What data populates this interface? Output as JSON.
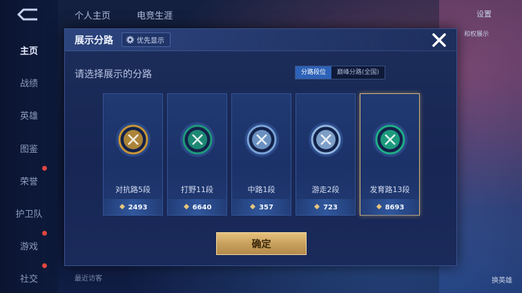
{
  "background": {
    "nav": [
      "主页",
      "战绩",
      "英雄",
      "图鉴",
      "荣誉",
      "护卫队",
      "游戏",
      "社交"
    ],
    "tabs": [
      "个人主页",
      "电竞生涯"
    ],
    "right_chips": [
      "设置",
      "和权展示",
      "换英雄"
    ],
    "bottom_text": "最近访客"
  },
  "modal": {
    "title": "展示分路",
    "priority_label": "优先显示",
    "subtitle": "请选择展示的分路",
    "toggle": {
      "left": "分路段位",
      "right": "巅峰分路(全国)",
      "active": "left"
    },
    "cards": [
      {
        "label": "对抗路5段",
        "score": "2493",
        "icon": "clash-lane-badge-icon",
        "color": "#c79536",
        "selected": false
      },
      {
        "label": "打野11段",
        "score": "6640",
        "icon": "jungle-badge-icon",
        "color": "#1f9a7a",
        "selected": false
      },
      {
        "label": "中路1段",
        "score": "357",
        "icon": "mid-lane-badge-icon",
        "color": "#7aa3d6",
        "selected": false
      },
      {
        "label": "游走2段",
        "score": "723",
        "icon": "roam-badge-icon",
        "color": "#8fb4dc",
        "selected": false
      },
      {
        "label": "发育路13段",
        "score": "8693",
        "icon": "farm-lane-badge-icon",
        "color": "#1fae86",
        "selected": true
      }
    ],
    "confirm_label": "确定"
  }
}
